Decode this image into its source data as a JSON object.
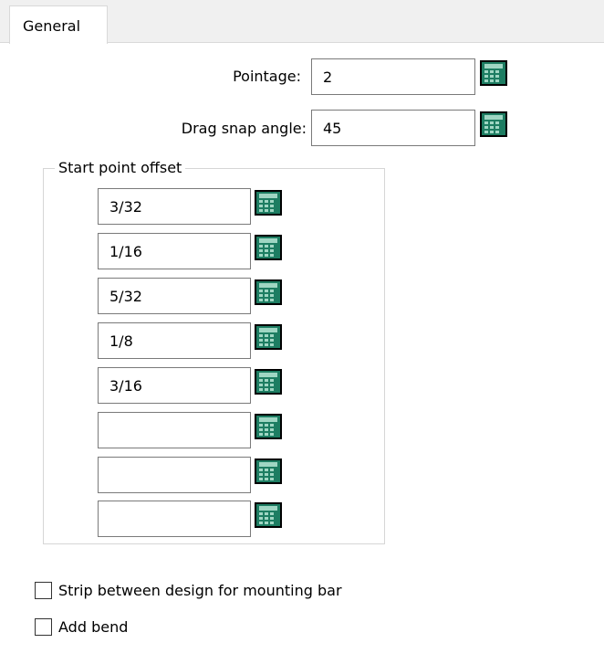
{
  "tabs": [
    {
      "label": "General",
      "active": true
    }
  ],
  "general": {
    "pointage": {
      "label": "Pointage:",
      "value": "2"
    },
    "drag_snap_angle": {
      "label": "Drag snap angle:",
      "value": "45"
    }
  },
  "start_point_offset": {
    "title": "Start point offset",
    "values": [
      "3/32",
      "1/16",
      "5/32",
      "1/8",
      "3/16",
      "",
      "",
      ""
    ]
  },
  "options": {
    "strip_between_design": {
      "label": "Strip between design for mounting bar",
      "checked": false
    },
    "add_bend": {
      "label": "Add bend",
      "checked": false
    }
  },
  "icons": {
    "calculator": "calculator-icon"
  },
  "colors": {
    "calculator_body": "#1d7d62",
    "calculator_keys": "#9fd6c3",
    "tab_strip": "#f0f0f0",
    "field_border": "#7a7a7a",
    "groupbox_border": "#d6d6d6"
  }
}
